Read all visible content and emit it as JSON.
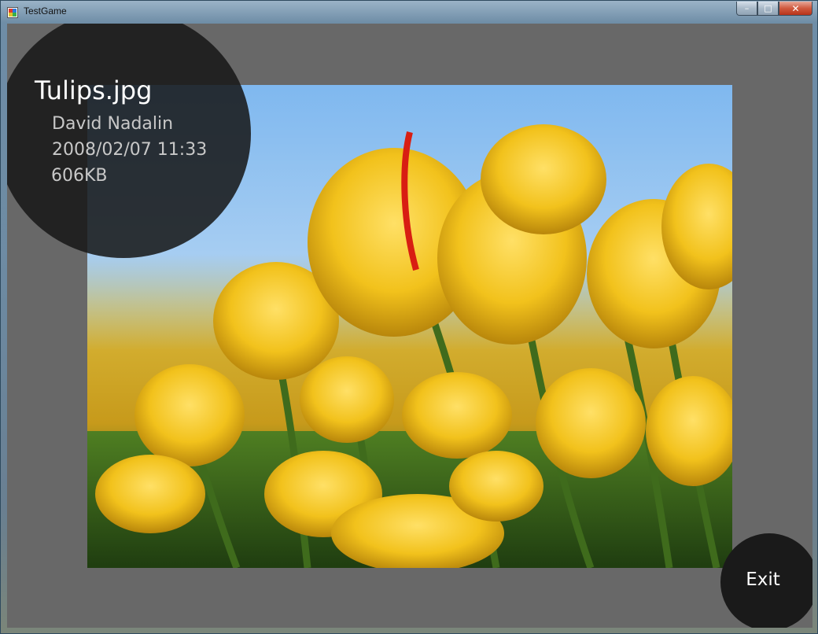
{
  "window": {
    "title": "TestGame",
    "buttons": {
      "minimize": "–",
      "maximize": "□",
      "close": "✕"
    }
  },
  "photo": {
    "name": "Tulips.jpg",
    "author": "David Nadalin",
    "datetime": "2008/02/07 11:33",
    "size": "606KB"
  },
  "exit_label": "Exit",
  "colors": {
    "panel_bg": "#686868",
    "circle_bg": "#161616",
    "title_text": "#ffffff",
    "meta_text": "#c8c8c8"
  }
}
